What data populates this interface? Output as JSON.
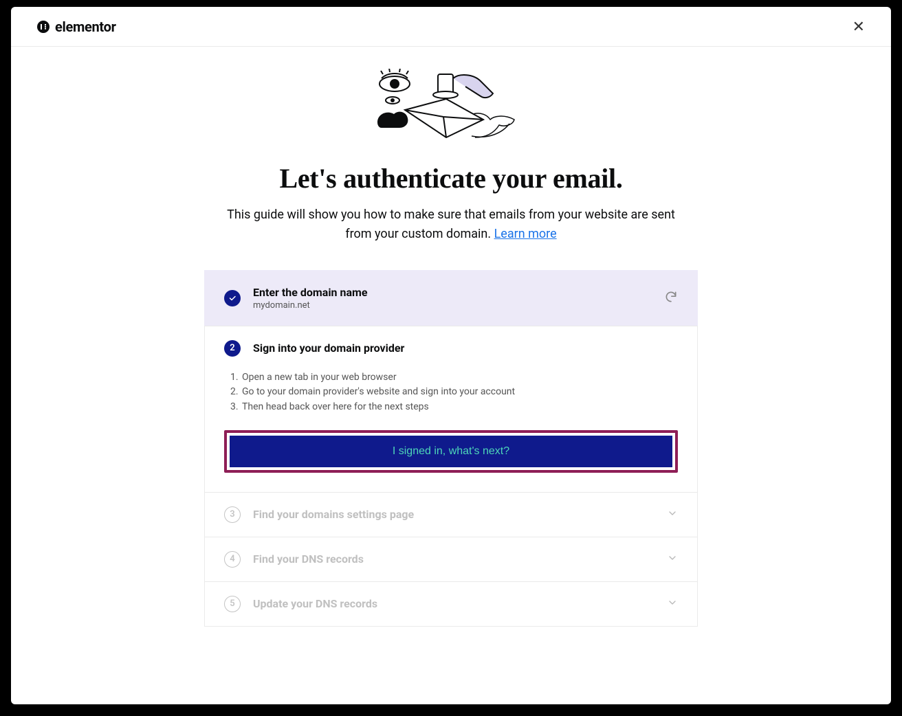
{
  "header": {
    "brand": "elementor"
  },
  "hero": {
    "title": "Let's authenticate your email.",
    "subtitle_before": "This guide will show you how to make sure that emails from your website are sent from your custom domain. ",
    "learn_more": "Learn more"
  },
  "steps": {
    "s1": {
      "title": "Enter the domain name",
      "value": "mydomain.net"
    },
    "s2": {
      "number": "2",
      "title": "Sign into your domain provider",
      "instructions": {
        "i1": "Open a new tab in your web browser",
        "i2": "Go to your domain provider's website and sign into your account",
        "i3": "Then head back over here for the next steps"
      },
      "cta": "I signed in, what's next?"
    },
    "s3": {
      "number": "3",
      "title": "Find your domains settings page"
    },
    "s4": {
      "number": "4",
      "title": "Find your DNS records"
    },
    "s5": {
      "number": "5",
      "title": "Update your DNS records"
    }
  }
}
